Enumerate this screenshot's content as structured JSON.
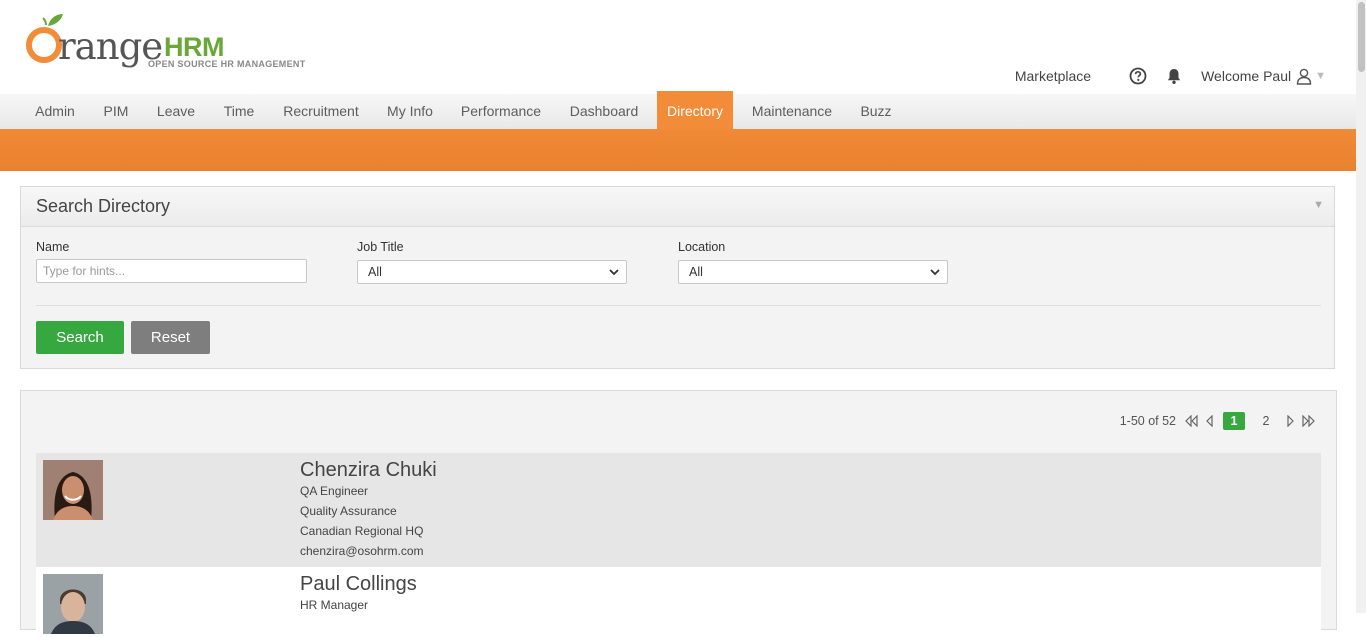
{
  "brand": {
    "word": "range",
    "suffix": "HRM",
    "tagline": "OPEN SOURCE HR MANAGEMENT"
  },
  "topbar": {
    "marketplace": "Marketplace",
    "welcome": "Welcome Paul"
  },
  "nav": [
    "Admin",
    "PIM",
    "Leave",
    "Time",
    "Recruitment",
    "My Info",
    "Performance",
    "Dashboard",
    "Directory",
    "Maintenance",
    "Buzz"
  ],
  "nav_active": "Directory",
  "search": {
    "title": "Search Directory",
    "name_label": "Name",
    "name_placeholder": "Type for hints...",
    "job_label": "Job Title",
    "job_value": "All",
    "location_label": "Location",
    "location_value": "All",
    "search_button": "Search",
    "reset_button": "Reset"
  },
  "pagination": {
    "range_text": "1-50 of 52",
    "pages": [
      "1",
      "2"
    ],
    "current": "1"
  },
  "employees": [
    {
      "name": "Chenzira Chuki",
      "title": "QA Engineer",
      "department": "Quality Assurance",
      "location": "Canadian Regional HQ",
      "email": "chenzira@osohrm.com"
    },
    {
      "name": "Paul Collings",
      "title": "HR Manager"
    }
  ],
  "colors": {
    "accent_orange": "#f28c38",
    "success_green": "#36a83f",
    "neutral_gray": "#7e7e7e"
  }
}
